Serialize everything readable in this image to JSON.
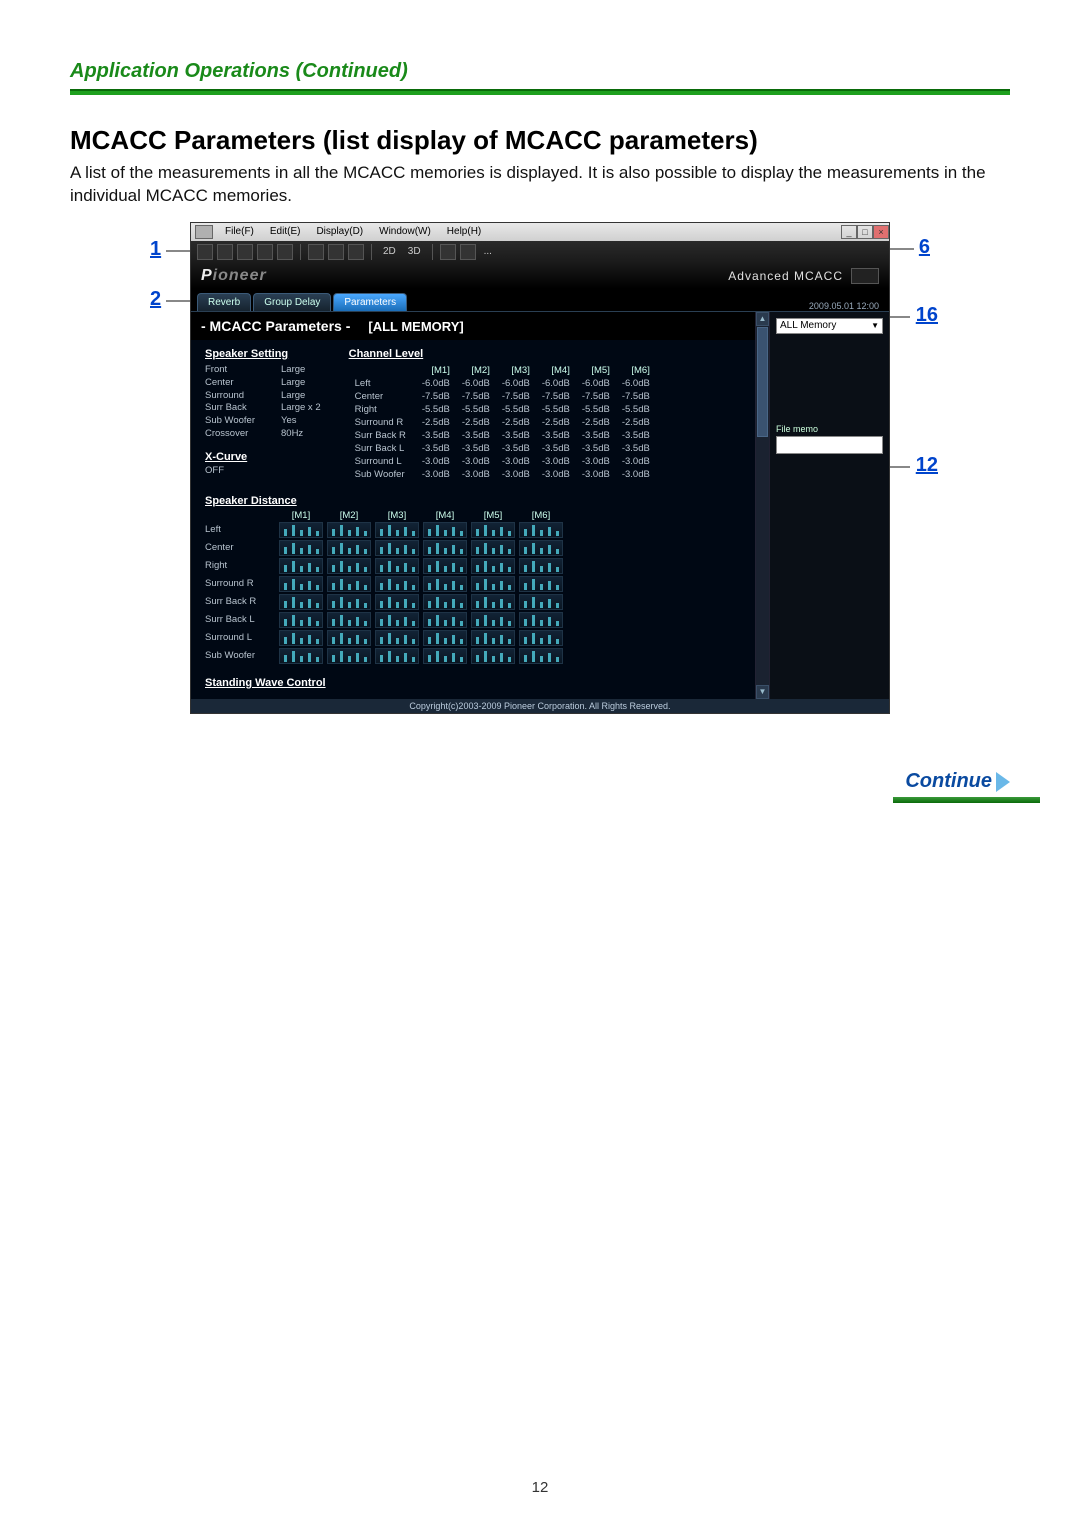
{
  "page": {
    "section_header": "Application Operations (Continued)",
    "title": "MCACC Parameters (list display of MCACC parameters)",
    "intro": "A list of the measurements in all the MCACC memories is displayed. It is also possible to display the measurements in the individual MCACC memories.",
    "continue": "Continue",
    "page_number": "12"
  },
  "callouts": {
    "c1": "1",
    "c2": "2",
    "c6": "6",
    "c16": "16",
    "c12": "12"
  },
  "app": {
    "menu": {
      "file": "File(F)",
      "edit": "Edit(E)",
      "display": "Display(D)",
      "window": "Window(W)",
      "help": "Help(H)"
    },
    "toolbar": {
      "label_2d": "2D",
      "label_3d": "3D",
      "dots": "..."
    },
    "brand": {
      "pioneer": "Pioneer",
      "product": "Advanced MCACC"
    },
    "timestamp": "2009.05.01 12:00",
    "tabs": {
      "reverb": "Reverb",
      "group_delay": "Group Delay",
      "parameters": "Parameters"
    },
    "side": {
      "select": "ALL Memory",
      "memo_label": "File memo"
    },
    "pane": {
      "title": "- MCACC Parameters -",
      "subtitle": "[ALL MEMORY]"
    },
    "speaker_setting": {
      "heading": "Speaker Setting",
      "rows": [
        {
          "k": "Front",
          "v": "Large"
        },
        {
          "k": "Center",
          "v": "Large"
        },
        {
          "k": "Surround",
          "v": "Large"
        },
        {
          "k": "Surr Back",
          "v": "Large x 2"
        },
        {
          "k": "Sub Woofer",
          "v": "Yes"
        },
        {
          "k": "Crossover",
          "v": "80Hz"
        }
      ],
      "xcurve_label": "X-Curve",
      "xcurve_value": "OFF"
    },
    "channel_level": {
      "heading": "Channel Level",
      "cols": [
        "[M1]",
        "[M2]",
        "[M3]",
        "[M4]",
        "[M5]",
        "[M6]"
      ],
      "rows": [
        {
          "label": "Left",
          "v": [
            "-6.0dB",
            "-6.0dB",
            "-6.0dB",
            "-6.0dB",
            "-6.0dB",
            "-6.0dB"
          ]
        },
        {
          "label": "Center",
          "v": [
            "-7.5dB",
            "-7.5dB",
            "-7.5dB",
            "-7.5dB",
            "-7.5dB",
            "-7.5dB"
          ]
        },
        {
          "label": "Right",
          "v": [
            "-5.5dB",
            "-5.5dB",
            "-5.5dB",
            "-5.5dB",
            "-5.5dB",
            "-5.5dB"
          ]
        },
        {
          "label": "Surround R",
          "v": [
            "-2.5dB",
            "-2.5dB",
            "-2.5dB",
            "-2.5dB",
            "-2.5dB",
            "-2.5dB"
          ]
        },
        {
          "label": "Surr Back R",
          "v": [
            "-3.5dB",
            "-3.5dB",
            "-3.5dB",
            "-3.5dB",
            "-3.5dB",
            "-3.5dB"
          ]
        },
        {
          "label": "Surr Back L",
          "v": [
            "-3.5dB",
            "-3.5dB",
            "-3.5dB",
            "-3.5dB",
            "-3.5dB",
            "-3.5dB"
          ]
        },
        {
          "label": "Surround L",
          "v": [
            "-3.0dB",
            "-3.0dB",
            "-3.0dB",
            "-3.0dB",
            "-3.0dB",
            "-3.0dB"
          ]
        },
        {
          "label": "Sub Woofer",
          "v": [
            "-3.0dB",
            "-3.0dB",
            "-3.0dB",
            "-3.0dB",
            "-3.0dB",
            "-3.0dB"
          ]
        }
      ]
    },
    "speaker_distance": {
      "heading": "Speaker Distance",
      "cols": [
        "[M1]",
        "[M2]",
        "[M3]",
        "[M4]",
        "[M5]",
        "[M6]"
      ],
      "rows": [
        "Left",
        "Center",
        "Right",
        "Surround R",
        "Surr Back R",
        "Surr Back L",
        "Surround L",
        "Sub Woofer"
      ]
    },
    "swc": {
      "heading": "Standing Wave Control"
    },
    "copyright": "Copyright(c)2003-2009 Pioneer Corporation. All Rights Reserved."
  }
}
